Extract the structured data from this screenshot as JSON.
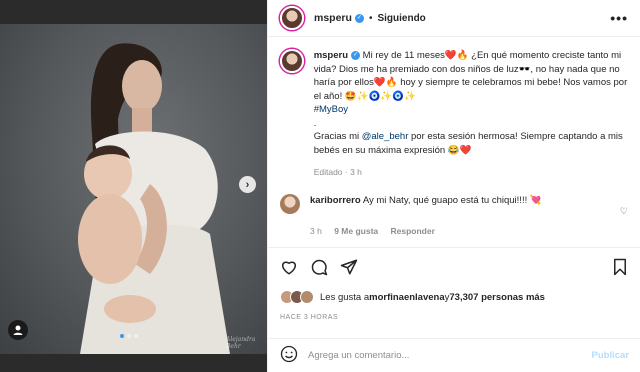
{
  "post": {
    "username": "msperu",
    "follow_status": "Siguiendo",
    "separator": "•",
    "more": "•••",
    "watermark": "Alejandra Behr",
    "caption_parts": {
      "p1": "Mi rey de 11 meses❤️🔥 ¿En qué momento creciste tanto mi vida? Dios me ha premiado con dos niños de luz🕶️, no hay nada que no haría por ellos❤️🔥 hoy y siempre te celebramos mi bebe! Nos vamos por el año! 🤩✨🧿✨🧿✨",
      "hashtag": "#MyBoy",
      "dot": ".",
      "p2a": "Gracias mi ",
      "mention": "@ale_behr",
      "p2b": " por esta sesión hermosa! Siempre captando a mis bebés en su máxima expresión 😂❤️"
    },
    "edited": "Editado · 3 h",
    "comment": {
      "username": "kariborrero",
      "text": "Ay mi Naty, qué guapo está tu chiqui!!!! 💘",
      "time": "3 h",
      "likes": "9 Me gusta",
      "reply": "Responder"
    },
    "likes": {
      "prefix": "Les gusta a ",
      "first_user": "morfinaenlavena",
      "connector": " y ",
      "others": "73,307 personas más"
    },
    "timestamp": "HACE 3 HORAS",
    "comment_input_placeholder": "Agrega un comentario...",
    "publish_label": "Publicar",
    "carousel": {
      "total": 3,
      "active": 1
    }
  },
  "icons": [
    "chevron-right-icon",
    "tag-user-icon",
    "emoji-icon",
    "heart-icon",
    "comment-icon",
    "share-icon",
    "bookmark-icon",
    "more-icon"
  ],
  "colors": {
    "link": "#00376b",
    "verified": "#3897f0",
    "publish_disabled": "#b2dffc",
    "muted": "#8e8e8e"
  }
}
